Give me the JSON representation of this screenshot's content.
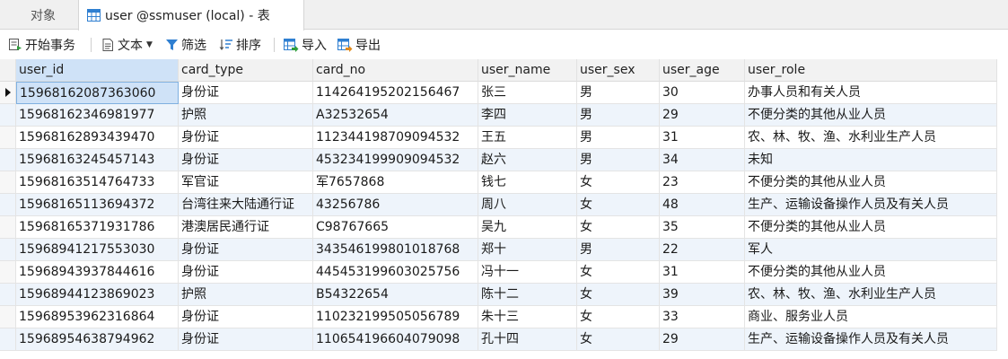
{
  "tabs": {
    "objects": "对象",
    "table": "user @ssmuser (local) - 表"
  },
  "toolbar": {
    "begin_transaction": "开始事务",
    "text": "文本",
    "filter": "筛选",
    "sort": "排序",
    "import": "导入",
    "export": "导出"
  },
  "grid": {
    "columns": [
      "user_id",
      "card_type",
      "card_no",
      "user_name",
      "user_sex",
      "user_age",
      "user_role"
    ],
    "rows": [
      [
        "15968162087363060",
        "身份证",
        "114264195202156467",
        "张三",
        "男",
        "30",
        "办事人员和有关人员"
      ],
      [
        "15968162346981977",
        "护照",
        "A32532654",
        "李四",
        "男",
        "29",
        "不便分类的其他从业人员"
      ],
      [
        "15968162893439470",
        "身份证",
        "112344198709094532",
        "王五",
        "男",
        "31",
        "农、林、牧、渔、水利业生产人员"
      ],
      [
        "15968163245457143",
        "身份证",
        "453234199909094532",
        "赵六",
        "男",
        "34",
        "未知"
      ],
      [
        "15968163514764733",
        "军官证",
        "军7657868",
        "钱七",
        "女",
        "23",
        "不便分类的其他从业人员"
      ],
      [
        "15968165113694372",
        "台湾往来大陆通行证",
        "43256786",
        "周八",
        "女",
        "48",
        "生产、运输设备操作人员及有关人员"
      ],
      [
        "15968165371931786",
        "港澳居民通行证",
        "C98767665",
        "吴九",
        "女",
        "35",
        "不便分类的其他从业人员"
      ],
      [
        "15968941217553030",
        "身份证",
        "343546199801018768",
        "郑十",
        "男",
        "22",
        "军人"
      ],
      [
        "15968943937844616",
        "身份证",
        "445453199603025756",
        "冯十一",
        "女",
        "31",
        "不便分类的其他从业人员"
      ],
      [
        "15968944123869023",
        "护照",
        "B54322654",
        "陈十二",
        "女",
        "39",
        "农、林、牧、渔、水利业生产人员"
      ],
      [
        "15968953962316864",
        "身份证",
        "110232199505056789",
        "朱十三",
        "女",
        "33",
        "商业、服务业人员"
      ],
      [
        "15968954638794962",
        "身份证",
        "110654196604079098",
        "孔十四",
        "女",
        "29",
        "生产、运输设备操作人员及有关人员"
      ]
    ]
  },
  "colors": {
    "selection": "#cfe2f7",
    "alt_row": "#eef4fb",
    "header_bg": "#f2f2f2",
    "icon_blue": "#2f7fd1"
  }
}
